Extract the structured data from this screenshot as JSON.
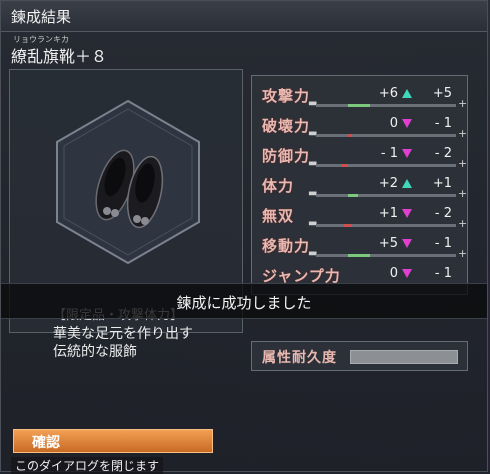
{
  "window": {
    "title": "鍊成結果",
    "item_furigana": "リョウランキカ",
    "item_name": "繚乱旗靴＋８"
  },
  "item": {
    "icon": "shoes-icon",
    "tag": "【限定品・攻撃体力】",
    "description_line1": "華美な足元を作り出す",
    "description_line2": "伝統的な服飾"
  },
  "stats": [
    {
      "label": "攻撃力",
      "before": "+6",
      "direction": "up",
      "after": "+5"
    },
    {
      "label": "破壊力",
      "before": "0",
      "direction": "down",
      "after": "- 1"
    },
    {
      "label": "防御力",
      "before": "- 1",
      "direction": "down",
      "after": "- 2"
    },
    {
      "label": "体力",
      "before": "+2",
      "direction": "up",
      "after": "+1"
    },
    {
      "label": "無双",
      "before": "+1",
      "direction": "down",
      "after": "- 2"
    },
    {
      "label": "移動力",
      "before": "+5",
      "direction": "down",
      "after": "- 1"
    },
    {
      "label": "ジャンプ力",
      "before": "0",
      "direction": "down",
      "after": "- 1"
    }
  ],
  "colors": {
    "up_arrow": "#40d8b8",
    "down_arrow": "#e040d0",
    "stat_label": "#e9b8b0",
    "confirm_bg": "#e08a3a"
  },
  "toast": {
    "message": "鍊成に成功しました"
  },
  "durability": {
    "label": "属性耐久度"
  },
  "footer": {
    "confirm_label": "確認",
    "hint": "このダイアログを閉じます"
  }
}
